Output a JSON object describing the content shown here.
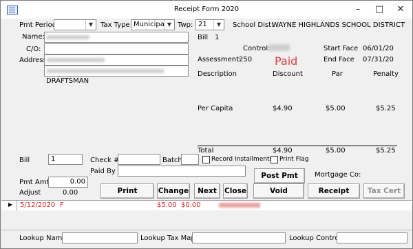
{
  "window": {
    "title": "Receipt Form 2020",
    "controls": [
      "–",
      "□",
      "✕"
    ]
  },
  "header": {
    "pmt_period_label": "Pmt Period",
    "pmt_period_value": "",
    "tax_type_label": "Tax Type",
    "tax_type_value": "Municipal",
    "twp_label": "Twp:",
    "twp_value": "21",
    "school_dist_label": "School Dist:",
    "school_dist_value": "WAYNE HIGHLANDS SCHOOL DISTRICT"
  },
  "owner": {
    "name_label": "Name:",
    "co_label": "C/O:",
    "address_label": "Address:",
    "address_line": "DRAFTSMAN"
  },
  "bill_info": {
    "bill_label": "Bill",
    "bill_value": "1",
    "control_label": "Control:",
    "assessment_label": "Assessment:",
    "assessment_value": "250",
    "status": "Paid",
    "start_face_label": "Start Face",
    "start_face_value": "06/01/20",
    "end_face_label": "End Face",
    "end_face_value": "07/31/20"
  },
  "table": {
    "headers": [
      "Description",
      "Discount",
      "Par",
      "Penalty"
    ],
    "rows": [
      {
        "description": "Per Capita",
        "discount": "$4.90",
        "par": "$5.00",
        "penalty": "$5.25"
      }
    ],
    "total": {
      "label": "Total",
      "discount": "$4.90",
      "par": "$5.00",
      "penalty": "$5.25"
    }
  },
  "payment": {
    "bill_label": "Bill",
    "bill_value": "1",
    "check_label": "Check #",
    "check_value": "",
    "batch_label": "Batch",
    "batch_value": "",
    "record_installments_label": "Record Installments",
    "print_flag_label": "Print Flag",
    "paid_by_label": "Paid By",
    "paid_by_value": "",
    "pmt_amt_label": "Pmt Amt",
    "pmt_amt_value": "0.00",
    "adjust_label": "Adjust",
    "adjust_value": "0.00",
    "mortgage_label": "Mortgage Co:"
  },
  "buttons": {
    "post_pmt": "Post Pmt",
    "print_receipt": "Print Receipt",
    "change": "Change",
    "next": "Next",
    "close": "Close",
    "void_receipt": "Void Receipt",
    "receipt_hist": "Receipt Hist.",
    "tax_cert": "Tax Cert"
  },
  "grid": {
    "row_marker": "▶",
    "date": "5/12/2020",
    "flag": "F",
    "amount1": "$5.00",
    "amount2": "$0.00"
  },
  "lookup": {
    "name_label": "Lookup Name",
    "tax_map_label": "Lookup Tax Map",
    "control_label": "Lookup Control"
  },
  "colors": {
    "paid": "#e23b3b",
    "grid_text": "#d22222"
  }
}
